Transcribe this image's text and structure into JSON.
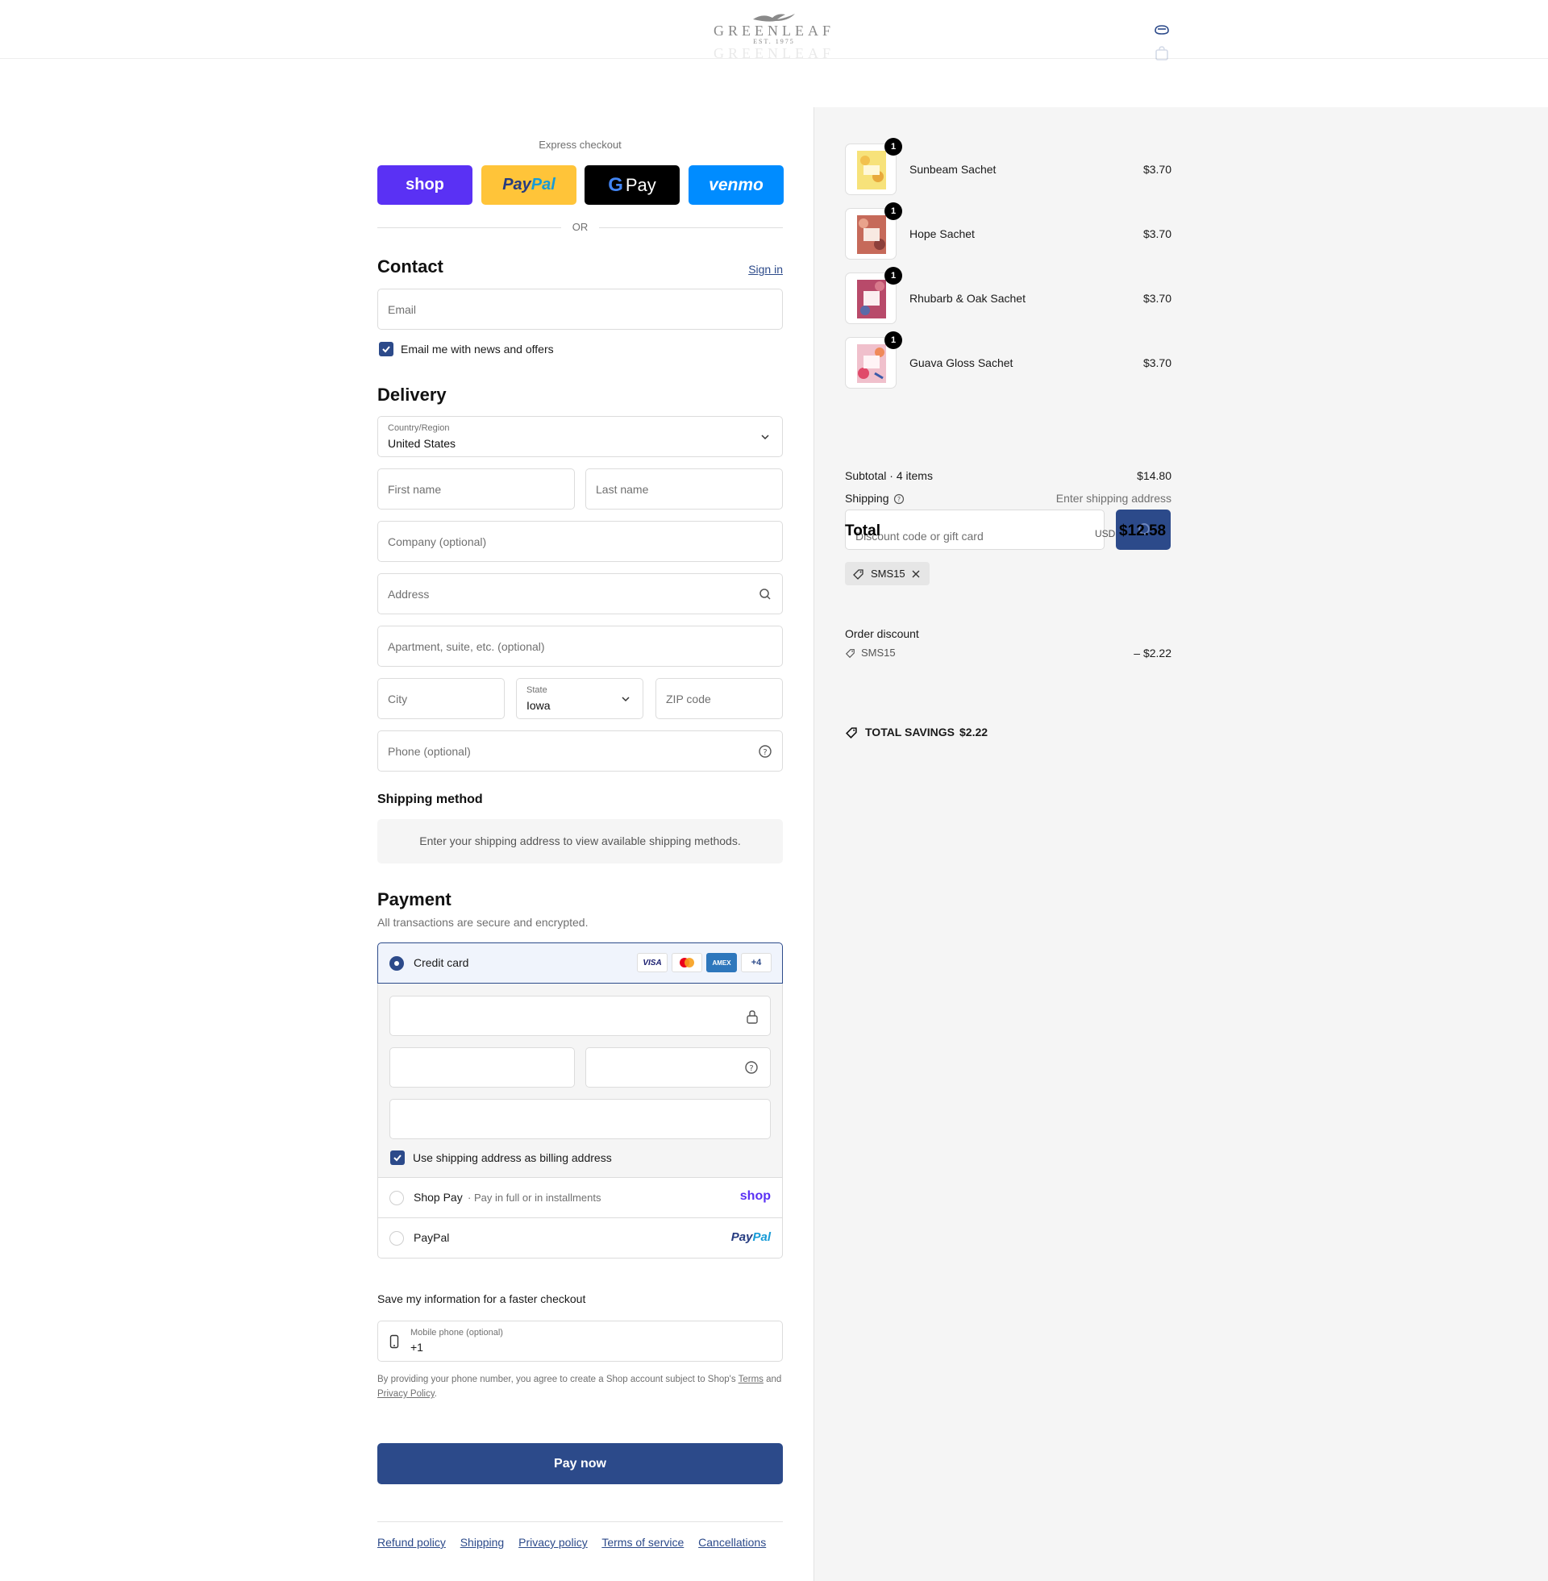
{
  "header": {
    "logo_name": "GREENLEAF",
    "logo_est": "EST. 1975"
  },
  "express": {
    "label": "Express checkout",
    "shop_label": "shop",
    "paypal_label_a": "Pay",
    "paypal_label_b": "Pal",
    "gpay_label": "Pay",
    "venmo_label": "venmo",
    "or_label": "OR"
  },
  "contact": {
    "title": "Contact",
    "sign_in": "Sign in",
    "email_placeholder": "Email",
    "newsletter_label": "Email me with news and offers"
  },
  "delivery": {
    "title": "Delivery",
    "country_label": "Country/Region",
    "country_value": "United States",
    "first_name": "First name",
    "last_name": "Last name",
    "company": "Company (optional)",
    "address": "Address",
    "apartment": "Apartment, suite, etc. (optional)",
    "city": "City",
    "state_label": "State",
    "state_value": "Iowa",
    "zip": "ZIP code",
    "phone": "Phone (optional)"
  },
  "shipping_method": {
    "title": "Shipping method",
    "notice": "Enter your shipping address to view available shipping methods."
  },
  "payment": {
    "title": "Payment",
    "subtitle": "All transactions are secure and encrypted.",
    "credit_card_label": "Credit card",
    "cards": [
      "VISA",
      "MC",
      "AMEX",
      "+4"
    ],
    "billing_same_label": "Use shipping address as billing address",
    "shop_pay_label": "Shop Pay",
    "shop_pay_sub": "· Pay in full or in installments",
    "shop_pay_logo": "shop",
    "paypal_label": "PayPal",
    "paypal_logo_a": "Pay",
    "paypal_logo_b": "Pal"
  },
  "save_info": {
    "title": "Save my information for a faster checkout",
    "mobile_label": "Mobile phone (optional)",
    "mobile_value": "+1",
    "disclaimer_a": "By providing your phone number, you agree to create a Shop account subject to Shop's",
    "terms": "Terms",
    "and": "and",
    "privacy": "Privacy Policy",
    "period": "."
  },
  "pay_now_label": "Pay now",
  "footer_links": [
    "Refund policy",
    "Shipping",
    "Privacy policy",
    "Terms of service",
    "Cancellations"
  ],
  "summary": {
    "items": [
      {
        "name": "Sunbeam Sachet",
        "price": "$3.70",
        "qty": "1"
      },
      {
        "name": "Hope Sachet",
        "price": "$3.70",
        "qty": "1"
      },
      {
        "name": "Rhubarb & Oak Sachet",
        "price": "$3.70",
        "qty": "1"
      },
      {
        "name": "Guava Gloss Sachet",
        "price": "$3.70",
        "qty": "1"
      }
    ],
    "subtotal_label": "Subtotal · 4 items",
    "subtotal_value": "$14.80",
    "shipping_label": "Shipping",
    "shipping_value": "Enter shipping address",
    "discount_placeholder": "Discount code or gift card",
    "total_label": "Total",
    "currency": "USD",
    "total_value": "$12.58",
    "applied_code": "SMS15",
    "order_discount_label": "Order discount",
    "order_discount_code": "SMS15",
    "order_discount_value": "– $2.22",
    "total_savings_label": "TOTAL SAVINGS",
    "total_savings_value": "$2.22"
  },
  "colors": {
    "accent": "#2c4a8a",
    "shop_purple": "#5a31f4",
    "paypal_yellow": "#ffc439",
    "venmo_blue": "#008cff"
  }
}
